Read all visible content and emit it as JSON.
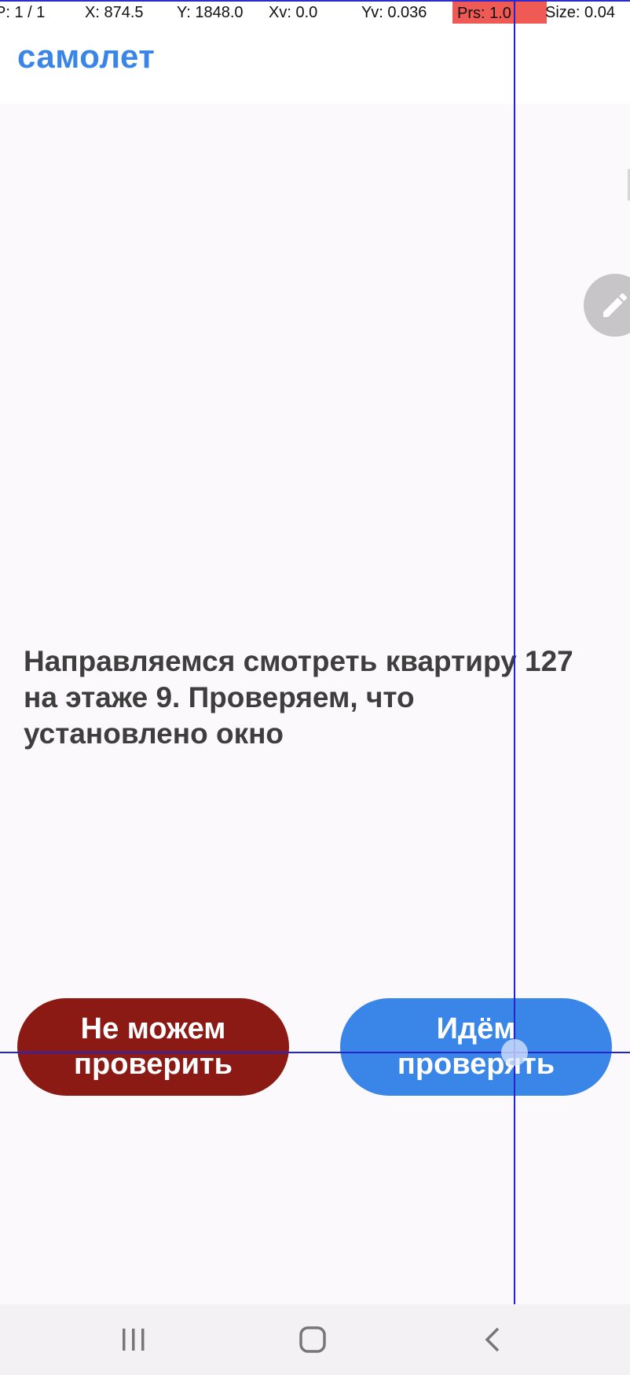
{
  "debug": {
    "pointer": "P: 1 / 1",
    "x": "X: 874.5",
    "y": "Y: 1848.0",
    "xv": "Xv: 0.0",
    "yv": "Yv: 0.036",
    "prs": "Prs: 1.0",
    "size": "Size: 0.04"
  },
  "header": {
    "title": "самолет"
  },
  "main": {
    "message": "Направляемся смотреть квартиру 127 на этаже 9. Проверяем, что установлено окно"
  },
  "actions": {
    "cannot_check": "Не можем проверить",
    "go_check": "Идём проверять"
  },
  "colors": {
    "accent": "#3a86e8",
    "danger": "#8b1a14",
    "background": "#fcf9fc"
  },
  "icons": {
    "fab": "pencil-icon",
    "nav_recent": "recent-apps-icon",
    "nav_home": "home-icon",
    "nav_back": "back-icon"
  }
}
